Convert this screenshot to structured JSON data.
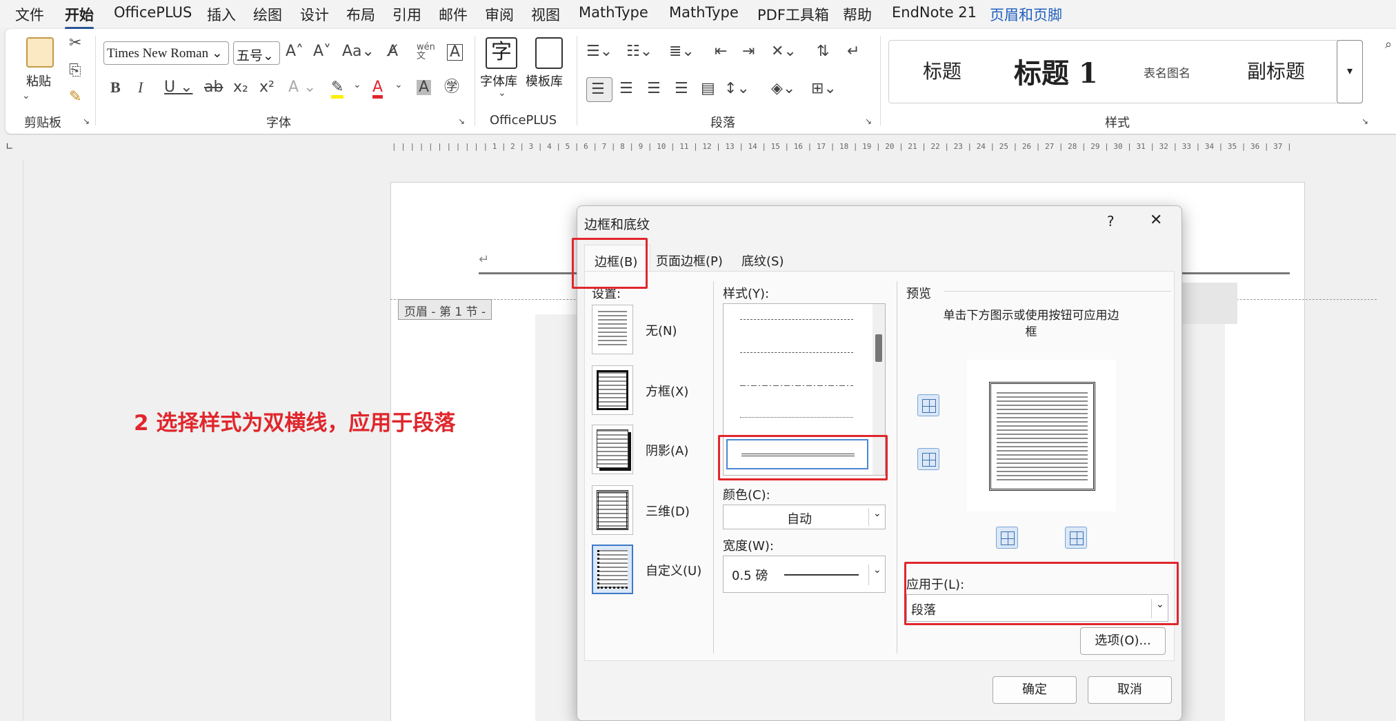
{
  "menu": {
    "tabs": [
      "文件",
      "开始",
      "OfficePLUS",
      "插入",
      "绘图",
      "设计",
      "布局",
      "引用",
      "邮件",
      "审阅",
      "视图",
      "MathType",
      "MathType",
      "PDF工具箱",
      "帮助",
      "EndNote 21",
      "页眉和页脚"
    ],
    "active": "开始"
  },
  "ribbon": {
    "clipboard": {
      "paste": "粘贴",
      "group": "剪贴板"
    },
    "font": {
      "name": "Times New Roman",
      "size": "五号",
      "group": "字体"
    },
    "officeplus": {
      "font_lib": "字体库",
      "template_lib": "模板库",
      "group": "OfficePLUS"
    },
    "paragraph": {
      "group": "段落"
    },
    "styles": {
      "items": [
        "标题",
        "标题 1",
        "表名图名",
        "副标题"
      ],
      "group": "样式"
    }
  },
  "document": {
    "header_tag": "页眉 - 第 1 节 -",
    "annotation": "2 选择样式为双横线，应用于段落"
  },
  "dialog": {
    "title": "边框和底纹",
    "help": "?",
    "close": "✕",
    "tabs": [
      "边框(B)",
      "页面边框(P)",
      "底纹(S)"
    ],
    "setting_label": "设置:",
    "settings": [
      "无(N)",
      "方框(X)",
      "阴影(A)",
      "三维(D)",
      "自定义(U)"
    ],
    "style_label": "样式(Y):",
    "color_label": "颜色(C):",
    "color_value": "自动",
    "width_label": "宽度(W):",
    "width_value": "0.5 磅",
    "preview_label": "预览",
    "preview_hint": "单击下方图示或使用按钮可应用边框",
    "apply_label": "应用于(L):",
    "apply_value": "段落",
    "options_button": "选项(O)...",
    "ok_button": "确定",
    "cancel_button": "取消"
  },
  "colors": {
    "highlight_red": "#e0262c",
    "accent_blue": "#2b5797"
  }
}
